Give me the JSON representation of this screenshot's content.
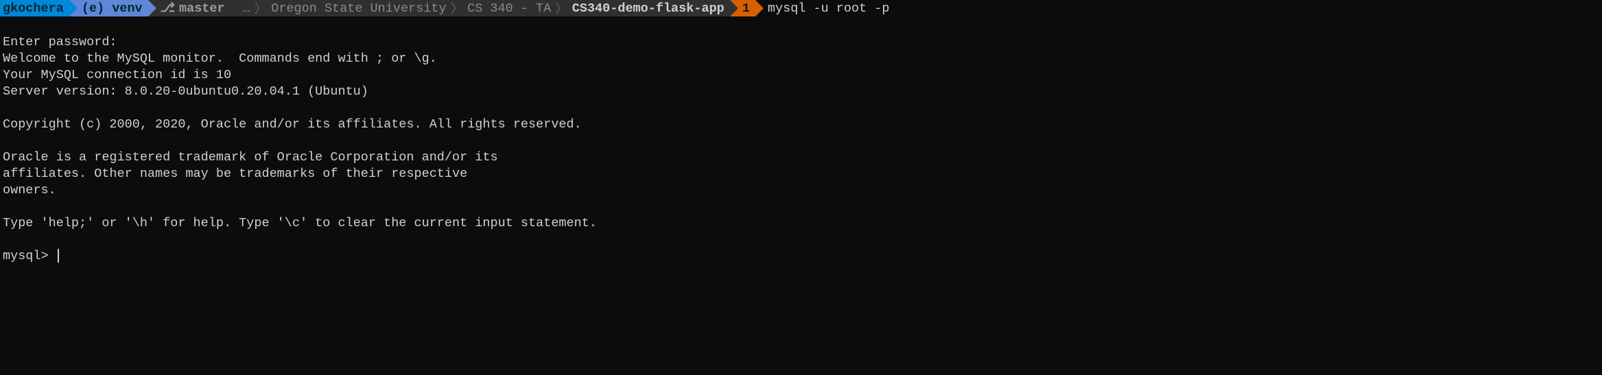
{
  "prompt": {
    "user": "gkochera",
    "venv": "(e) venv",
    "branch_icon": "⎇",
    "branch": "master",
    "path_ellipsis": "…",
    "path_parts": [
      "Oregon State University",
      "CS 340 - TA"
    ],
    "path_current": "CS340-demo-flask-app",
    "badge": "1",
    "command": "mysql -u root -p"
  },
  "output": {
    "line1": "Enter password:",
    "line2": "Welcome to the MySQL monitor.  Commands end with ; or \\g.",
    "line3": "Your MySQL connection id is 10",
    "line4": "Server version: 8.0.20-0ubuntu0.20.04.1 (Ubuntu)",
    "line5": "",
    "line6": "Copyright (c) 2000, 2020, Oracle and/or its affiliates. All rights reserved.",
    "line7": "",
    "line8": "Oracle is a registered trademark of Oracle Corporation and/or its",
    "line9": "affiliates. Other names may be trademarks of their respective",
    "line10": "owners.",
    "line11": "",
    "line12": "Type 'help;' or '\\h' for help. Type '\\c' to clear the current input statement.",
    "line13": "",
    "mysql_prompt": "mysql> "
  }
}
